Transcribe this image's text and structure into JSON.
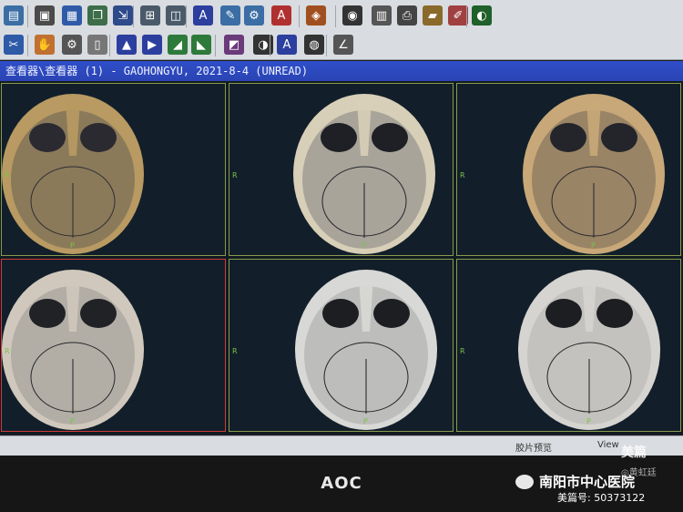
{
  "toolbar": {
    "row1": [
      {
        "icon": "app-icon",
        "color": "#3a6ea5"
      },
      {
        "icon": "save-icon",
        "color": "#4a4a4a"
      },
      {
        "icon": "document-icon",
        "color": "#2e5aa8"
      },
      {
        "icon": "copy-icon",
        "color": "#3d6e4a"
      },
      {
        "icon": "export-icon",
        "color": "#2e4a8a"
      },
      {
        "icon": "layout-grid-icon",
        "color": "#4a5a6a"
      },
      {
        "icon": "layout-split-icon",
        "color": "#4a5a6a"
      },
      {
        "icon": "annotate-icon",
        "color": "#2c3e9e"
      },
      {
        "icon": "measure-icon",
        "color": "#3a6ea5"
      },
      {
        "icon": "tool-icon",
        "color": "#3a6ea5"
      },
      {
        "icon": "text-annotation-icon",
        "color": "#b03030"
      },
      {
        "icon": "filter-icon",
        "color": "#a05020"
      },
      {
        "icon": "cine-icon",
        "color": "#333333"
      },
      {
        "icon": "calculator-icon",
        "color": "#555555"
      },
      {
        "icon": "print-icon",
        "color": "#444444"
      },
      {
        "icon": "printer-icon",
        "color": "#8a6a2a"
      },
      {
        "icon": "film-icon",
        "color": "#a04040"
      },
      {
        "icon": "color-map-icon",
        "color": "#20602a"
      }
    ],
    "row2": [
      {
        "icon": "tools-icon",
        "color": "#2e5aa8"
      },
      {
        "icon": "hand-icon",
        "color": "#c07030"
      },
      {
        "icon": "settings-icon",
        "color": "#555555"
      },
      {
        "icon": "sheet-icon",
        "color": "#777777"
      },
      {
        "icon": "rotate-icon",
        "color": "#2c3e9e"
      },
      {
        "icon": "flip-icon",
        "color": "#2c3e9e"
      },
      {
        "icon": "zoom-icon",
        "color": "#2e7a3a"
      },
      {
        "icon": "pan-icon",
        "color": "#2e7a3a"
      },
      {
        "icon": "crop-icon",
        "color": "#6a3a7a"
      },
      {
        "icon": "contrast-icon",
        "color": "#333333"
      },
      {
        "icon": "auto-window-icon",
        "color": "#2c3e9e"
      },
      {
        "icon": "invert-icon",
        "color": "#333333"
      },
      {
        "icon": "angle-icon",
        "color": "#555555"
      }
    ]
  },
  "title_bar": {
    "text": "查看器\\查看器 (1) - GAOHONGYU, 2021-8-4 (UNREAD)"
  },
  "viewer": {
    "orientation_label": "R",
    "bottom_label": "P",
    "cells": [
      {
        "active": false
      },
      {
        "active": false
      },
      {
        "active": false
      },
      {
        "active": true
      },
      {
        "active": false
      },
      {
        "active": false
      }
    ]
  },
  "status_bar": {
    "preview_label": "胶片预览",
    "view_label": "View"
  },
  "monitor": {
    "brand": "AOC"
  },
  "watermark": {
    "top_text": "美篇",
    "signature": "◎黄虹廷",
    "hospital": "南阳市中心医院",
    "account": "美篇号: 50373122"
  }
}
